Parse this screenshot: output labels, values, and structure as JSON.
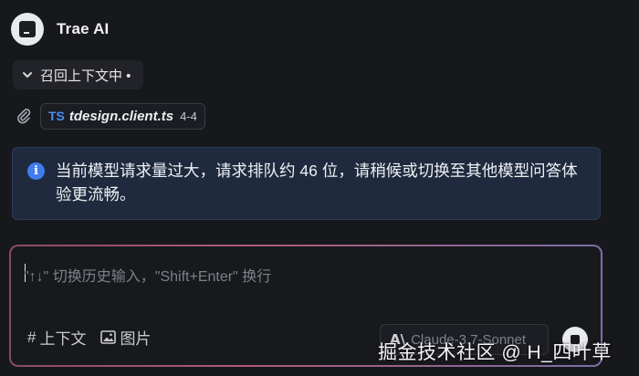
{
  "header": {
    "title": "Trae AI",
    "avatar_icon": "trae-logo-icon"
  },
  "recall": {
    "label": "召回上下文中 •",
    "icon": "chevron-down-icon"
  },
  "file_ref": {
    "icon": "paperclip-icon",
    "lang_badge": "TS",
    "file_name": "tdesign.client.ts",
    "range": "4-4"
  },
  "notice": {
    "icon": "info-icon",
    "icon_glyph": "i",
    "text": "当前模型请求量过大，请求排队约 46 位，请稍候或切换至其他模型问答体验更流畅。"
  },
  "input": {
    "placeholder": "\"↑↓\" 切换历史输入，\"Shift+Enter\" 换行",
    "context_label": "上下文",
    "context_glyph": "#",
    "image_label": "图片",
    "model_logo": "A\\",
    "model_name": "Claude-3.7-Sonnet",
    "send_icon": "send-icon"
  },
  "watermark": "掘金技术社区 @ H_四叶草",
  "colors": {
    "accent": "#3f7cf0",
    "notice_bg": "#1f2a3e",
    "border_gradient_start": "#8a4a63",
    "border_gradient_end": "#7a6fa6"
  }
}
